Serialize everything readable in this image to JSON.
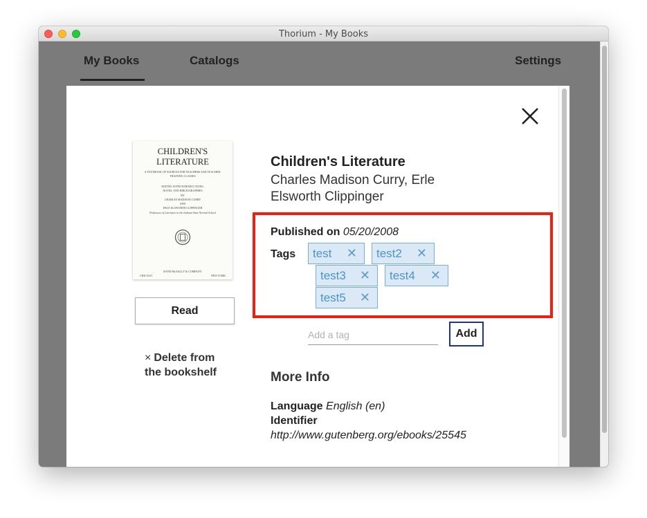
{
  "window": {
    "title": "Thorium - My Books"
  },
  "nav": {
    "my_books": "My Books",
    "catalogs": "Catalogs",
    "settings": "Settings"
  },
  "cover": {
    "title_line1": "CHILDREN'S",
    "title_line2": "LITERATURE",
    "subtitle1": "A TEXTBOOK OF SOURCES FOR TEACHERS AND TEACHER-",
    "subtitle2": "TRAINING CLASSES",
    "edited1": "EDITED, WITH INTRODUCTIONS,",
    "edited2": "NOTES, AND BIBLIOGRAPHIES",
    "by": "BY",
    "author1": "CHARLES MADISON CURRY",
    "and": "AND",
    "author2": "ERLE ELSWORTH CLIPPINGER",
    "affil": "Professors of Literature in the Indiana State Normal School",
    "publisher": "RAND McNALLY & COMPANY",
    "city_left": "CHICAGO",
    "city_right": "NEW YORK"
  },
  "actions": {
    "read": "Read",
    "delete_icon": "×",
    "delete_line1": "Delete from",
    "delete_line2": "the bookshelf"
  },
  "book": {
    "title": "Children's Literature",
    "authors_line1": "Charles Madison Curry, Erle",
    "authors_line2": "Elsworth Clippinger",
    "published_label": "Published on",
    "published_date": "05/20/2008",
    "tags_label": "Tags",
    "tags": [
      "test",
      "test2",
      "test3",
      "test4",
      "test5"
    ]
  },
  "tag_remove_icon": "✕",
  "add_tag": {
    "placeholder": "Add a tag",
    "button": "Add"
  },
  "more_info": {
    "title": "More Info",
    "language_label": "Language",
    "language_value": "English (en)",
    "identifier_label": "Identifier",
    "identifier_value": "http://www.gutenberg.org/ebooks/25545"
  },
  "colors": {
    "highlight": "#f41c0c",
    "tag_bg": "#dae9f5",
    "tag_text": "#4d93cc",
    "add_button_border": "#1a30a8"
  }
}
